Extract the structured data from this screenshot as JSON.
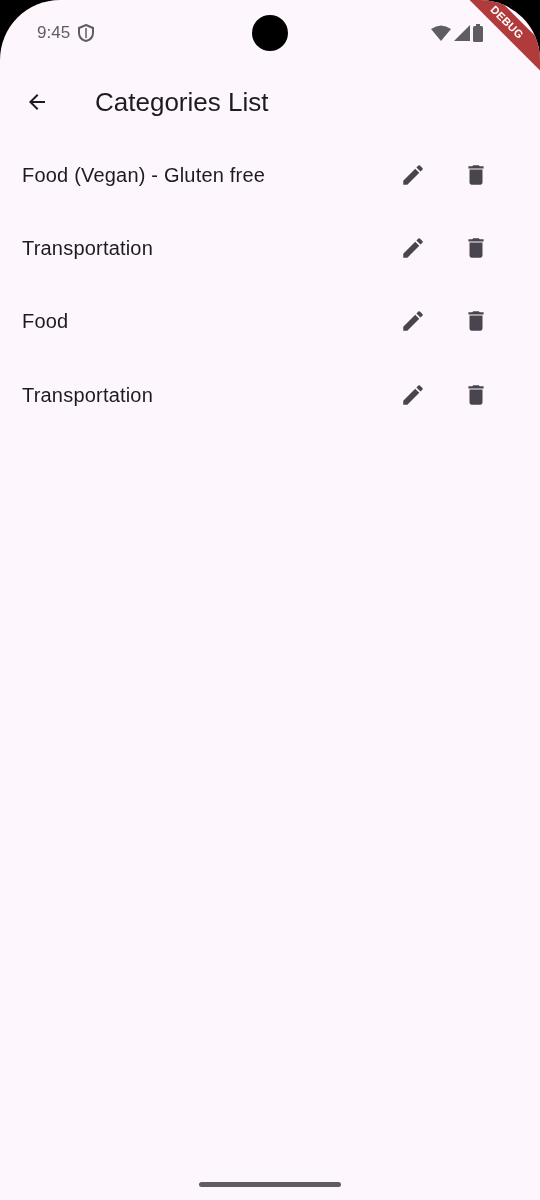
{
  "status_bar": {
    "time": "9:45"
  },
  "debug_banner": "DEBUG",
  "app_bar": {
    "title": "Categories List"
  },
  "categories": [
    {
      "name": "Food (Vegan) - Gluten free"
    },
    {
      "name": "Transportation"
    },
    {
      "name": "Food"
    },
    {
      "name": "Transportation"
    }
  ]
}
